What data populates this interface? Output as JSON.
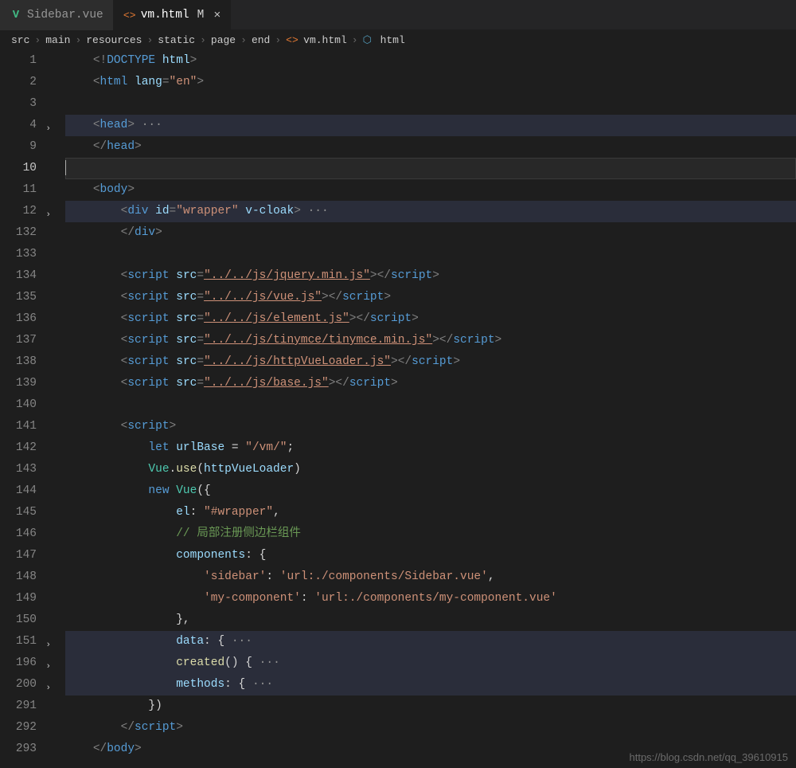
{
  "tabs": [
    {
      "icon": "vue",
      "label": "Sidebar.vue",
      "modified": "",
      "active": false
    },
    {
      "icon": "html",
      "label": "vm.html",
      "modified": "M",
      "active": true
    }
  ],
  "breadcrumbs": {
    "items": [
      "src",
      "main",
      "resources",
      "static",
      "page",
      "end"
    ],
    "fileIcon": "<>",
    "file": "vm.html",
    "symbolIcon": "⬡",
    "symbol": "html"
  },
  "lines": [
    {
      "n": "1",
      "fold": "",
      "hl": false,
      "tokens": [
        [
          "    ",
          ""
        ],
        [
          "<!",
          " t-punc"
        ],
        [
          "DOCTYPE",
          " t-tag"
        ],
        [
          " ",
          ""
        ],
        [
          "html",
          " t-attr"
        ],
        [
          ">",
          " t-punc"
        ]
      ]
    },
    {
      "n": "2",
      "fold": "",
      "hl": false,
      "tokens": [
        [
          "    ",
          ""
        ],
        [
          "<",
          " t-punc"
        ],
        [
          "html",
          " t-tag"
        ],
        [
          " ",
          ""
        ],
        [
          "lang",
          " t-attr"
        ],
        [
          "=",
          " t-punc"
        ],
        [
          "\"en\"",
          " t-str"
        ],
        [
          ">",
          " t-punc"
        ]
      ]
    },
    {
      "n": "3",
      "fold": "",
      "hl": false,
      "tokens": [
        [
          "",
          ""
        ]
      ]
    },
    {
      "n": "4",
      "fold": ">",
      "hl": true,
      "tokens": [
        [
          "    ",
          ""
        ],
        [
          "<",
          " t-punc"
        ],
        [
          "head",
          " t-tag"
        ],
        [
          ">",
          " t-punc"
        ],
        [
          " ···",
          " t-dots"
        ]
      ]
    },
    {
      "n": "9",
      "fold": "",
      "hl": false,
      "tokens": [
        [
          "    ",
          ""
        ],
        [
          "</",
          " t-punc"
        ],
        [
          "head",
          " t-tag"
        ],
        [
          ">",
          " t-punc"
        ]
      ]
    },
    {
      "n": "10",
      "fold": "",
      "hl": false,
      "current": true,
      "tokens": [
        [
          "",
          ""
        ]
      ]
    },
    {
      "n": "11",
      "fold": "",
      "hl": false,
      "tokens": [
        [
          "    ",
          ""
        ],
        [
          "<",
          " t-punc"
        ],
        [
          "body",
          " t-tag"
        ],
        [
          ">",
          " t-punc"
        ]
      ]
    },
    {
      "n": "12",
      "fold": ">",
      "hl": true,
      "tokens": [
        [
          "        ",
          ""
        ],
        [
          "<",
          " t-punc"
        ],
        [
          "div",
          " t-tag"
        ],
        [
          " ",
          ""
        ],
        [
          "id",
          " t-attr"
        ],
        [
          "=",
          " t-punc"
        ],
        [
          "\"wrapper\"",
          " t-str"
        ],
        [
          " ",
          ""
        ],
        [
          "v-cloak",
          " t-attr"
        ],
        [
          ">",
          " t-punc"
        ],
        [
          " ···",
          " t-dots"
        ]
      ]
    },
    {
      "n": "132",
      "fold": "",
      "hl": false,
      "tokens": [
        [
          "        ",
          ""
        ],
        [
          "</",
          " t-punc"
        ],
        [
          "div",
          " t-tag"
        ],
        [
          ">",
          " t-punc"
        ]
      ]
    },
    {
      "n": "133",
      "fold": "",
      "hl": false,
      "tokens": [
        [
          "",
          ""
        ]
      ]
    },
    {
      "n": "134",
      "fold": "",
      "hl": false,
      "tokens": [
        [
          "        ",
          ""
        ],
        [
          "<",
          " t-punc"
        ],
        [
          "script",
          " t-tag"
        ],
        [
          " ",
          ""
        ],
        [
          "src",
          " t-attr"
        ],
        [
          "=",
          " t-punc"
        ],
        [
          "\"../../js/jquery.min.js\"",
          " t-str underline"
        ],
        [
          ">",
          " t-punc"
        ],
        [
          "</",
          " t-punc"
        ],
        [
          "script",
          " t-tag"
        ],
        [
          ">",
          " t-punc"
        ]
      ]
    },
    {
      "n": "135",
      "fold": "",
      "hl": false,
      "tokens": [
        [
          "        ",
          ""
        ],
        [
          "<",
          " t-punc"
        ],
        [
          "script",
          " t-tag"
        ],
        [
          " ",
          ""
        ],
        [
          "src",
          " t-attr"
        ],
        [
          "=",
          " t-punc"
        ],
        [
          "\"../../js/vue.js\"",
          " t-str underline"
        ],
        [
          ">",
          " t-punc"
        ],
        [
          "</",
          " t-punc"
        ],
        [
          "script",
          " t-tag"
        ],
        [
          ">",
          " t-punc"
        ]
      ]
    },
    {
      "n": "136",
      "fold": "",
      "hl": false,
      "tokens": [
        [
          "        ",
          ""
        ],
        [
          "<",
          " t-punc"
        ],
        [
          "script",
          " t-tag"
        ],
        [
          " ",
          ""
        ],
        [
          "src",
          " t-attr"
        ],
        [
          "=",
          " t-punc"
        ],
        [
          "\"../../js/element.js\"",
          " t-str underline"
        ],
        [
          ">",
          " t-punc"
        ],
        [
          "</",
          " t-punc"
        ],
        [
          "script",
          " t-tag"
        ],
        [
          ">",
          " t-punc"
        ]
      ]
    },
    {
      "n": "137",
      "fold": "",
      "hl": false,
      "tokens": [
        [
          "        ",
          ""
        ],
        [
          "<",
          " t-punc"
        ],
        [
          "script",
          " t-tag"
        ],
        [
          " ",
          ""
        ],
        [
          "src",
          " t-attr"
        ],
        [
          "=",
          " t-punc"
        ],
        [
          "\"../../js/tinymce/tinymce.min.js\"",
          " t-str underline"
        ],
        [
          ">",
          " t-punc"
        ],
        [
          "</",
          " t-punc"
        ],
        [
          "script",
          " t-tag"
        ],
        [
          ">",
          " t-punc"
        ]
      ]
    },
    {
      "n": "138",
      "fold": "",
      "hl": false,
      "tokens": [
        [
          "        ",
          ""
        ],
        [
          "<",
          " t-punc"
        ],
        [
          "script",
          " t-tag"
        ],
        [
          " ",
          ""
        ],
        [
          "src",
          " t-attr"
        ],
        [
          "=",
          " t-punc"
        ],
        [
          "\"../../js/httpVueLoader.js\"",
          " t-str underline"
        ],
        [
          ">",
          " t-punc"
        ],
        [
          "</",
          " t-punc"
        ],
        [
          "script",
          " t-tag"
        ],
        [
          ">",
          " t-punc"
        ]
      ]
    },
    {
      "n": "139",
      "fold": "",
      "hl": false,
      "tokens": [
        [
          "        ",
          ""
        ],
        [
          "<",
          " t-punc"
        ],
        [
          "script",
          " t-tag"
        ],
        [
          " ",
          ""
        ],
        [
          "src",
          " t-attr"
        ],
        [
          "=",
          " t-punc"
        ],
        [
          "\"../../js/base.js\"",
          " t-str underline"
        ],
        [
          ">",
          " t-punc"
        ],
        [
          "</",
          " t-punc"
        ],
        [
          "script",
          " t-tag"
        ],
        [
          ">",
          " t-punc"
        ]
      ]
    },
    {
      "n": "140",
      "fold": "",
      "hl": false,
      "tokens": [
        [
          "",
          ""
        ]
      ]
    },
    {
      "n": "141",
      "fold": "",
      "hl": false,
      "tokens": [
        [
          "        ",
          ""
        ],
        [
          "<",
          " t-punc"
        ],
        [
          "script",
          " t-tag"
        ],
        [
          ">",
          " t-punc"
        ]
      ]
    },
    {
      "n": "142",
      "fold": "",
      "hl": false,
      "tokens": [
        [
          "            ",
          ""
        ],
        [
          "let",
          " t-kw"
        ],
        [
          " ",
          ""
        ],
        [
          "urlBase",
          " t-var"
        ],
        [
          " = ",
          ""
        ],
        [
          "\"/vm/\"",
          " t-str"
        ],
        [
          ";",
          ""
        ]
      ]
    },
    {
      "n": "143",
      "fold": "",
      "hl": false,
      "tokens": [
        [
          "            ",
          ""
        ],
        [
          "Vue",
          " t-cls"
        ],
        [
          ".",
          ""
        ],
        [
          "use",
          " t-fn"
        ],
        [
          "(",
          ""
        ],
        [
          "httpVueLoader",
          " t-var"
        ],
        [
          ")",
          ""
        ]
      ]
    },
    {
      "n": "144",
      "fold": "",
      "hl": false,
      "tokens": [
        [
          "            ",
          ""
        ],
        [
          "new",
          " t-kw"
        ],
        [
          " ",
          ""
        ],
        [
          "Vue",
          " t-cls"
        ],
        [
          "({",
          ""
        ]
      ]
    },
    {
      "n": "145",
      "fold": "",
      "hl": false,
      "tokens": [
        [
          "                ",
          ""
        ],
        [
          "el",
          " t-var"
        ],
        [
          ": ",
          ""
        ],
        [
          "\"#wrapper\"",
          " t-str"
        ],
        [
          ",",
          ""
        ]
      ]
    },
    {
      "n": "146",
      "fold": "",
      "hl": false,
      "tokens": [
        [
          "                ",
          ""
        ],
        [
          "// 局部注册侧边栏组件",
          " t-comm"
        ]
      ]
    },
    {
      "n": "147",
      "fold": "",
      "hl": false,
      "tokens": [
        [
          "                ",
          ""
        ],
        [
          "components",
          " t-var"
        ],
        [
          ": {",
          ""
        ]
      ]
    },
    {
      "n": "148",
      "fold": "",
      "hl": false,
      "tokens": [
        [
          "                    ",
          ""
        ],
        [
          "'sidebar'",
          " t-str"
        ],
        [
          ": ",
          ""
        ],
        [
          "'url:./components/Sidebar.vue'",
          " t-str"
        ],
        [
          ",",
          ""
        ]
      ]
    },
    {
      "n": "149",
      "fold": "",
      "hl": false,
      "tokens": [
        [
          "                    ",
          ""
        ],
        [
          "'my-component'",
          " t-str"
        ],
        [
          ": ",
          ""
        ],
        [
          "'url:./components/my-component.vue'",
          " t-str"
        ]
      ]
    },
    {
      "n": "150",
      "fold": "",
      "hl": false,
      "tokens": [
        [
          "                ",
          ""
        ],
        [
          "},",
          ""
        ]
      ]
    },
    {
      "n": "151",
      "fold": ">",
      "hl": true,
      "tokens": [
        [
          "                ",
          ""
        ],
        [
          "data",
          " t-var"
        ],
        [
          ": {",
          ""
        ],
        [
          " ···",
          " t-dots"
        ]
      ]
    },
    {
      "n": "196",
      "fold": ">",
      "hl": true,
      "tokens": [
        [
          "                ",
          ""
        ],
        [
          "created",
          " t-fn"
        ],
        [
          "() {",
          ""
        ],
        [
          " ···",
          " t-dots"
        ]
      ]
    },
    {
      "n": "200",
      "fold": ">",
      "hl": true,
      "tokens": [
        [
          "                ",
          ""
        ],
        [
          "methods",
          " t-var"
        ],
        [
          ": {",
          ""
        ],
        [
          " ···",
          " t-dots"
        ]
      ]
    },
    {
      "n": "291",
      "fold": "",
      "hl": false,
      "tokens": [
        [
          "            ",
          ""
        ],
        [
          "})",
          ""
        ]
      ]
    },
    {
      "n": "292",
      "fold": "",
      "hl": false,
      "tokens": [
        [
          "        ",
          ""
        ],
        [
          "</",
          " t-punc"
        ],
        [
          "script",
          " t-tag"
        ],
        [
          ">",
          " t-punc"
        ]
      ]
    },
    {
      "n": "293",
      "fold": "",
      "hl": false,
      "tokens": [
        [
          "    ",
          ""
        ],
        [
          "</",
          " t-punc"
        ],
        [
          "body",
          " t-tag"
        ],
        [
          ">",
          " t-punc"
        ]
      ]
    }
  ],
  "watermark": "https://blog.csdn.net/qq_39610915"
}
